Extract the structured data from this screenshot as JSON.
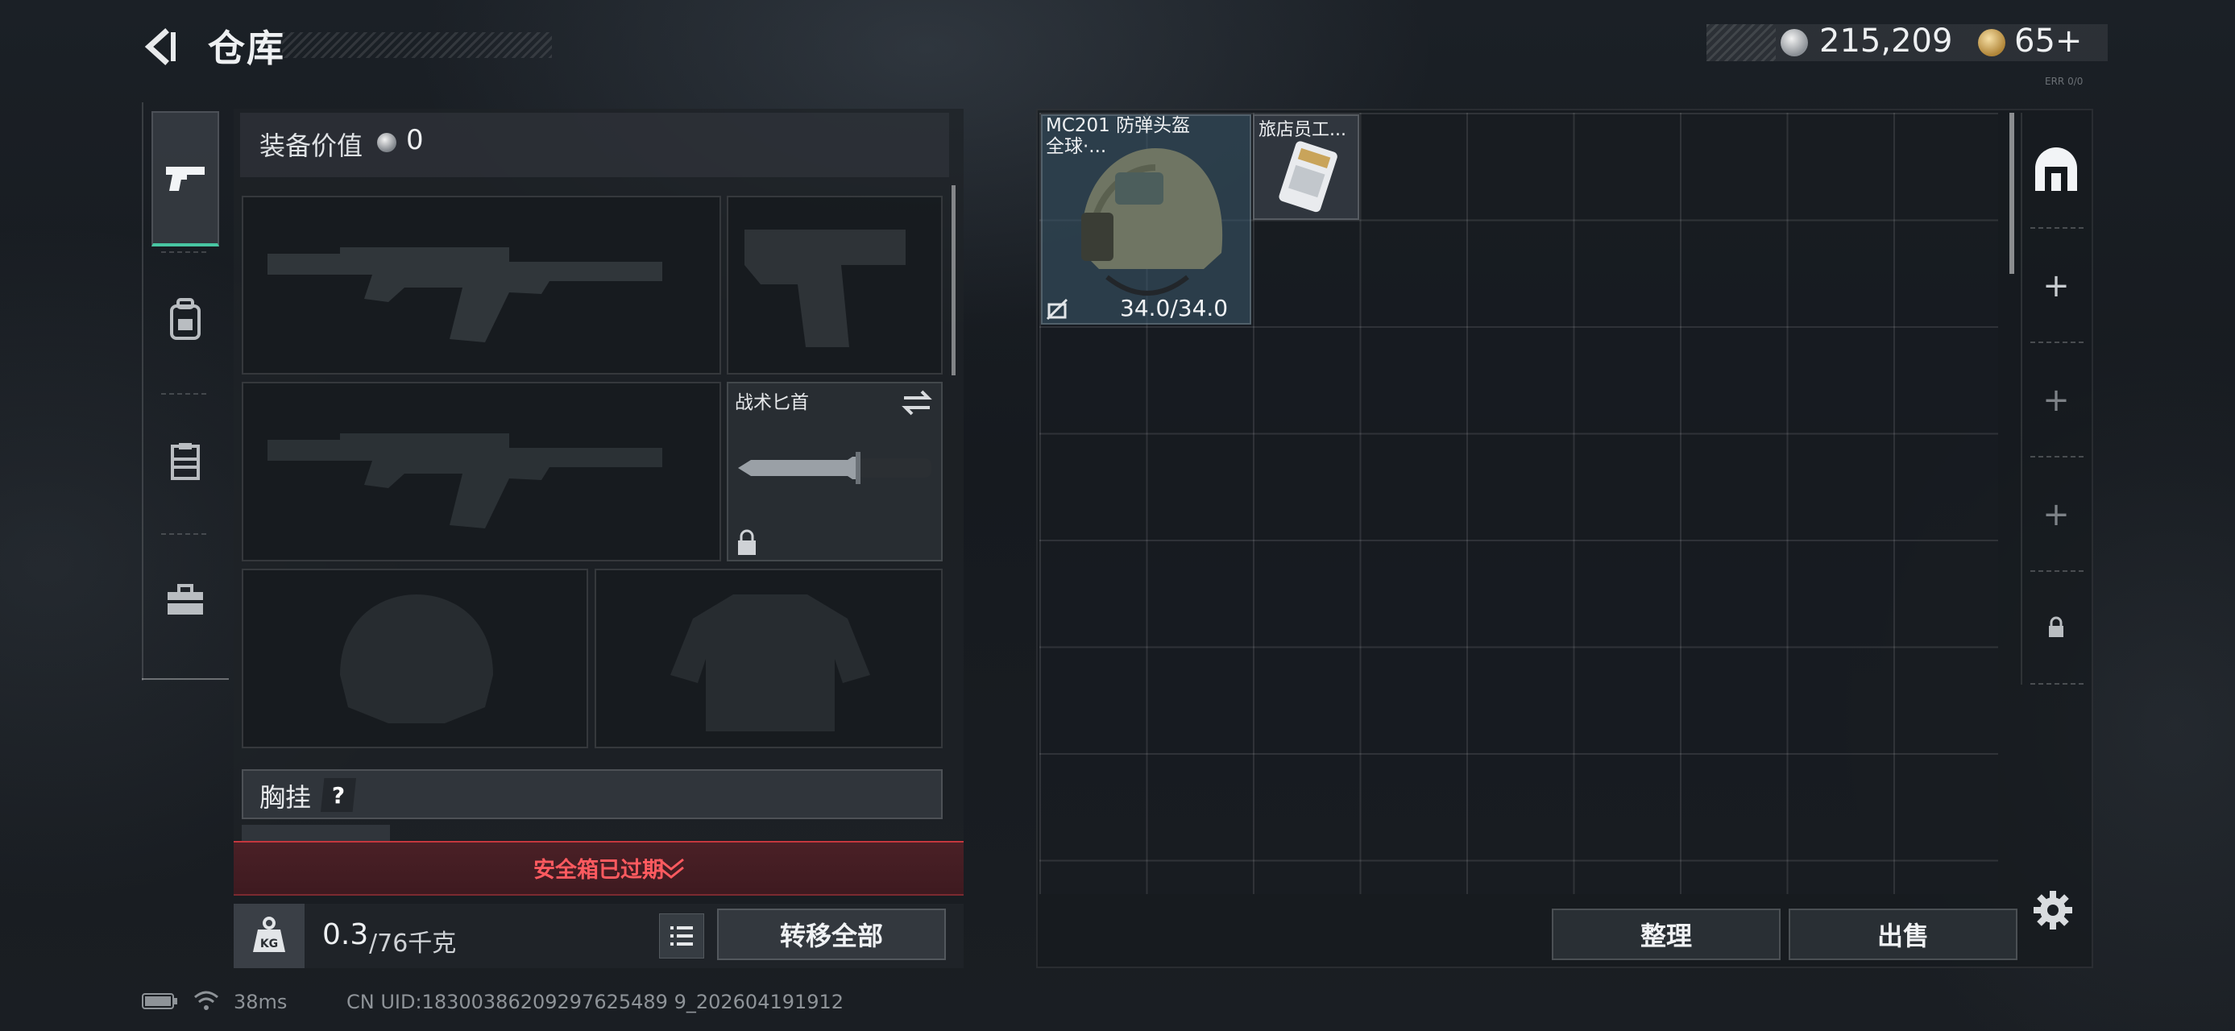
{
  "header": {
    "title": "仓库",
    "money": "215,209",
    "premium": "65+",
    "small_tag": "ERR 0/0"
  },
  "sidebar": {
    "tabs": [
      {
        "name": "weapons",
        "icon": "pistol-icon",
        "active": true
      },
      {
        "name": "gear",
        "icon": "backpack-icon",
        "active": false
      },
      {
        "name": "rig",
        "icon": "vest-icon",
        "active": false
      },
      {
        "name": "tools",
        "icon": "toolbox-icon",
        "active": false
      }
    ]
  },
  "equipment": {
    "value_label": "装备价值",
    "value": "0",
    "melee_name": "战术匕首",
    "chest_label": "胸挂",
    "chest_help": "?",
    "safebox_text": "安全箱已过期",
    "weight_current": "0.3",
    "weight_max": "/76千克",
    "transfer_all": "转移全部"
  },
  "storage": {
    "items": [
      {
        "name": "MC201 防弹头盔\n全球·...",
        "durability": "34.0/34.0"
      },
      {
        "name": "旅店员工..."
      }
    ],
    "sort_label": "整理",
    "sell_label": "出售",
    "container_tabs": [
      {
        "icon": "vault-icon"
      },
      {
        "icon": "plus-icon",
        "label": "+"
      },
      {
        "icon": "plus-icon",
        "label": "+"
      },
      {
        "icon": "plus-icon",
        "label": "+"
      },
      {
        "icon": "lock-icon"
      }
    ]
  },
  "status": {
    "ping": "38ms",
    "uid": "CN UID:18300386209297625489 9_202604191912"
  },
  "colors": {
    "accent": "#48c6a2",
    "warning": "#ff5a5f",
    "panel": "#1e2227"
  }
}
